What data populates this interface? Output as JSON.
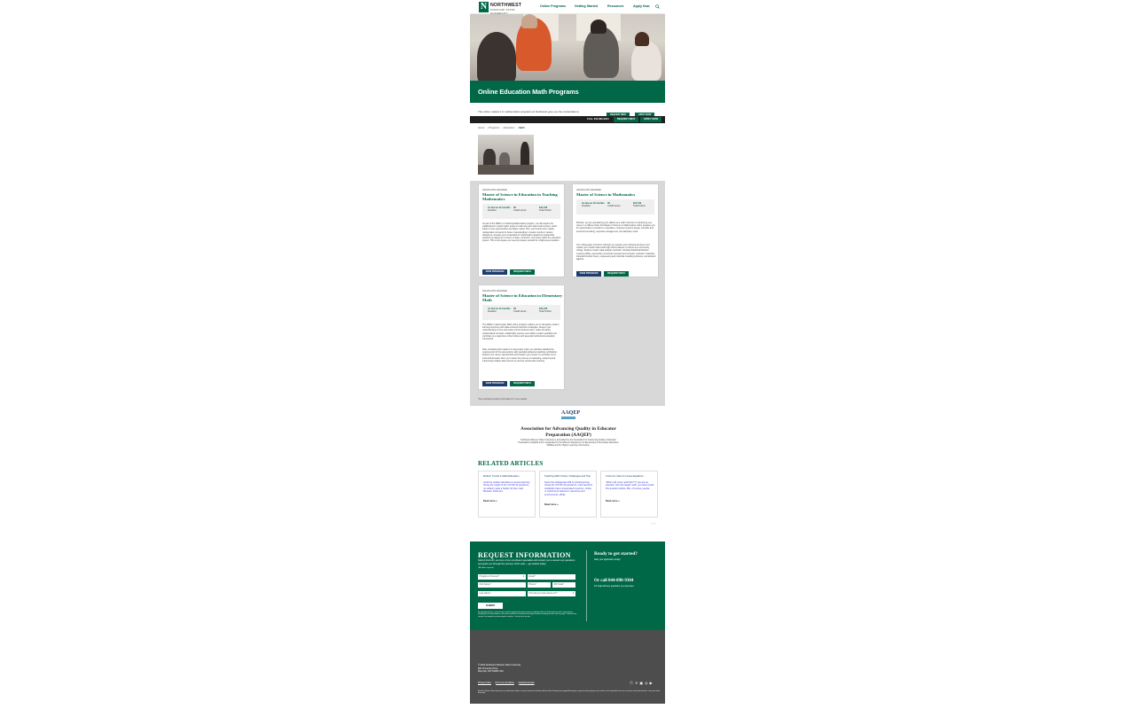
{
  "header": {
    "logo_mark": "N",
    "logo_name": "NORTHWEST",
    "logo_sub": "MISSOURI STATE UNIVERSITY",
    "nav": [
      "Online Programs",
      "Getting Started",
      "Resources",
      "Apply Now"
    ],
    "search_icon": "search-icon"
  },
  "hero": {
    "title": "Online Education Math Programs",
    "intro": "The online master's in mathematics programs at Northwest give you the credentials to"
  },
  "sticky": {
    "call": "CALL 844-890-9304",
    "request": "REQUEST INFO",
    "apply": "APPLY NOW",
    "ghost_request": "REQUEST INFO",
    "ghost_apply": "APPLY NOW"
  },
  "breadcrumb": [
    "Home",
    "Programs",
    "Education",
    "Math"
  ],
  "programs": [
    {
      "kicker": "GRADUATE DEGREE",
      "title": "Master of Science in Education in Teaching Mathematics",
      "duration": "As few as 12 months",
      "duration_label": "Duration",
      "credits": "30",
      "credits_label": "Credit Hours",
      "tuition": "$11,730",
      "tuition_label": "Total Tuition",
      "desc": "As part of the MSEd. in Teaching Mathematics program, you will acquire the qualifications to teach higher levels of math and earn dual-credit courses, which leads to more opportunities and higher salary. Plus, you'll study how to apply mathematics concepts for better understanding in modern trends in various disciplines, increase your credentials for mathematics department leadership positions by taking our courses on data, curriculum, and issues within the education system. This is the degree you need to prepare yourself for a higher-level position.",
      "btn_view": "VIEW PROGRAM",
      "btn_req": "REQUEST INFO"
    },
    {
      "kicker": "GRADUATE DEGREE",
      "title": "Master of Science in Mathematics",
      "duration": "As few as 12 months",
      "duration_label": "Duration",
      "credits": "30",
      "credits_label": "Credit Hours",
      "tuition": "$11,730",
      "tuition_label": "Total Tuition",
      "desc": "Whether you are specializing your skillset as a math instructor or advancing your career in a different field, this Master of Science in Mathematics online prepares you for opportunities in positions in education, computer systems design, scientific and technical consulting, corporate management, and laboratory work.",
      "desc2": "Our cutting-edge curriculum will help you elevate your professional career and enable you to teach dual-credit high school classes or instruct at a community college. Explore modern data analysis methods, including Statistical Machine Learning (SML), elementary numerical concepts and computer methods in statistics, industrial number theory, engineering and industrial modeling problems, and abstract algebra.",
      "btn_view": "VIEW PROGRAM",
      "btn_req": "REQUEST INFO"
    },
    {
      "kicker": "GRADUATE DEGREE",
      "title": "Master of Science in Education in Elementary Math",
      "duration": "As few as 12 months",
      "duration_label": "Duration",
      "credits": "30",
      "credits_label": "Credit Hours",
      "tuition": "$11,730",
      "tuition_label": "Total Tuition",
      "desc": "The MSEd. in Elementary Math online program enables you to strengthen student learning outcomes with data-centered instruction strategies. Deepen your understanding of how elementary school students learn, relate and apply mathematical concepts. Additionally, improve your ability to teach equitably and contribute to a supportive school culture with essential multicultural education coursework.",
      "desc2": "After completing this master's in elementary math, you will have satisfied the requirements for the elementary math specialist advanced teaching certification. Expand your career opportunities and broaden your impact on education as an instructional leader when you master the process of evaluating, analyzing and interpreting multiple data sources to promote school-wide learning.",
      "btn_view": "VIEW PROGRAM",
      "btn_req": "REQUEST INFO"
    }
  ],
  "footnote": "*See individual program information for more details.",
  "aaqep": {
    "logo_text": "AAQEP",
    "title": "Association for Advancing Quality in Educator Preparation (AAQEP)",
    "text": "Northwest Missouri State University is accredited by the Association for Advancing Quality in Educator Preparation (AAQEP) and is designated by the Missouri Department of Elementary & Secondary Education (DESE) and the Higher Learning Commission."
  },
  "related": {
    "title": "RELATED ARTICLES",
    "articles": [
      {
        "title": "Modern Trends in Math Education",
        "body": "Amid the sudden transition to remote learning during the height of the COVID-19 pandemic, no subject made a harder hit than math. Between 2019 and",
        "read": "Read more »"
      },
      {
        "title": "Teaching Math Online: Challenges and Tips",
        "body": "Since the widespread shift to virtual learning during the COVID-19 pandemic, math teachers worldwide have incorporated in-person, online or hybrid best classroom resources and environments. While",
        "read": "Read more »"
      },
      {
        "title": "Common Uses for Linear Equations",
        "body": "\"When will I ever need this?\" If you are an educator who has taught math, you have heard this question before. But, of course, people",
        "read": "Read more »"
      }
    ],
    "arrows": "‹ ›"
  },
  "request": {
    "title": "REQUEST INFORMATION",
    "text": "Submit this form, and one of our enrollment specialists will contact you to answer any questions and guide you through the process. Don't wait — get started today!",
    "required": "*All fields required",
    "fields": {
      "program": "Program of Interest*",
      "email": "Email*",
      "first": "First Name*",
      "phone": "Phone*",
      "zip": "ZIP Code*",
      "last": "Last Name*",
      "heard": "How did you hear about us?*"
    },
    "submit": "SUBMIT",
    "disclaimer": "By submitting this form, I consent to be contacted regarding educational services by Northwest Missouri State University and its representatives, including by email and telephone at the number provided, via automated technology. Standard messaging and data rates may apply. I understand my consent is not required to purchase goods or services. I can opt out at any time.",
    "ready_title": "Ready to get started?",
    "ready_sub": "Start your application today!",
    "call_title": "Or call 844-890-9304",
    "call_sub": "For help with any questions you may have."
  },
  "footer": {
    "copy_lines": [
      "© 2024 Northwest Missouri State University",
      "800 University Drive",
      "Maryville, MO 64468 USA"
    ],
    "links": [
      "Privacy Policy",
      "Terms & Conditions",
      "Institutional data"
    ],
    "social": [
      "facebook-icon",
      "x-icon",
      "linkedin-icon",
      "instagram-icon",
      "youtube-icon"
    ],
    "legal": "Northwest Missouri State University is accredited by the Higher Learning Commission. Northwest Missouri State University has engaged Everspring to support its online programs and consults, and is responsible for its own curriculum, faculty and instruction. Learn more about Everspring."
  }
}
